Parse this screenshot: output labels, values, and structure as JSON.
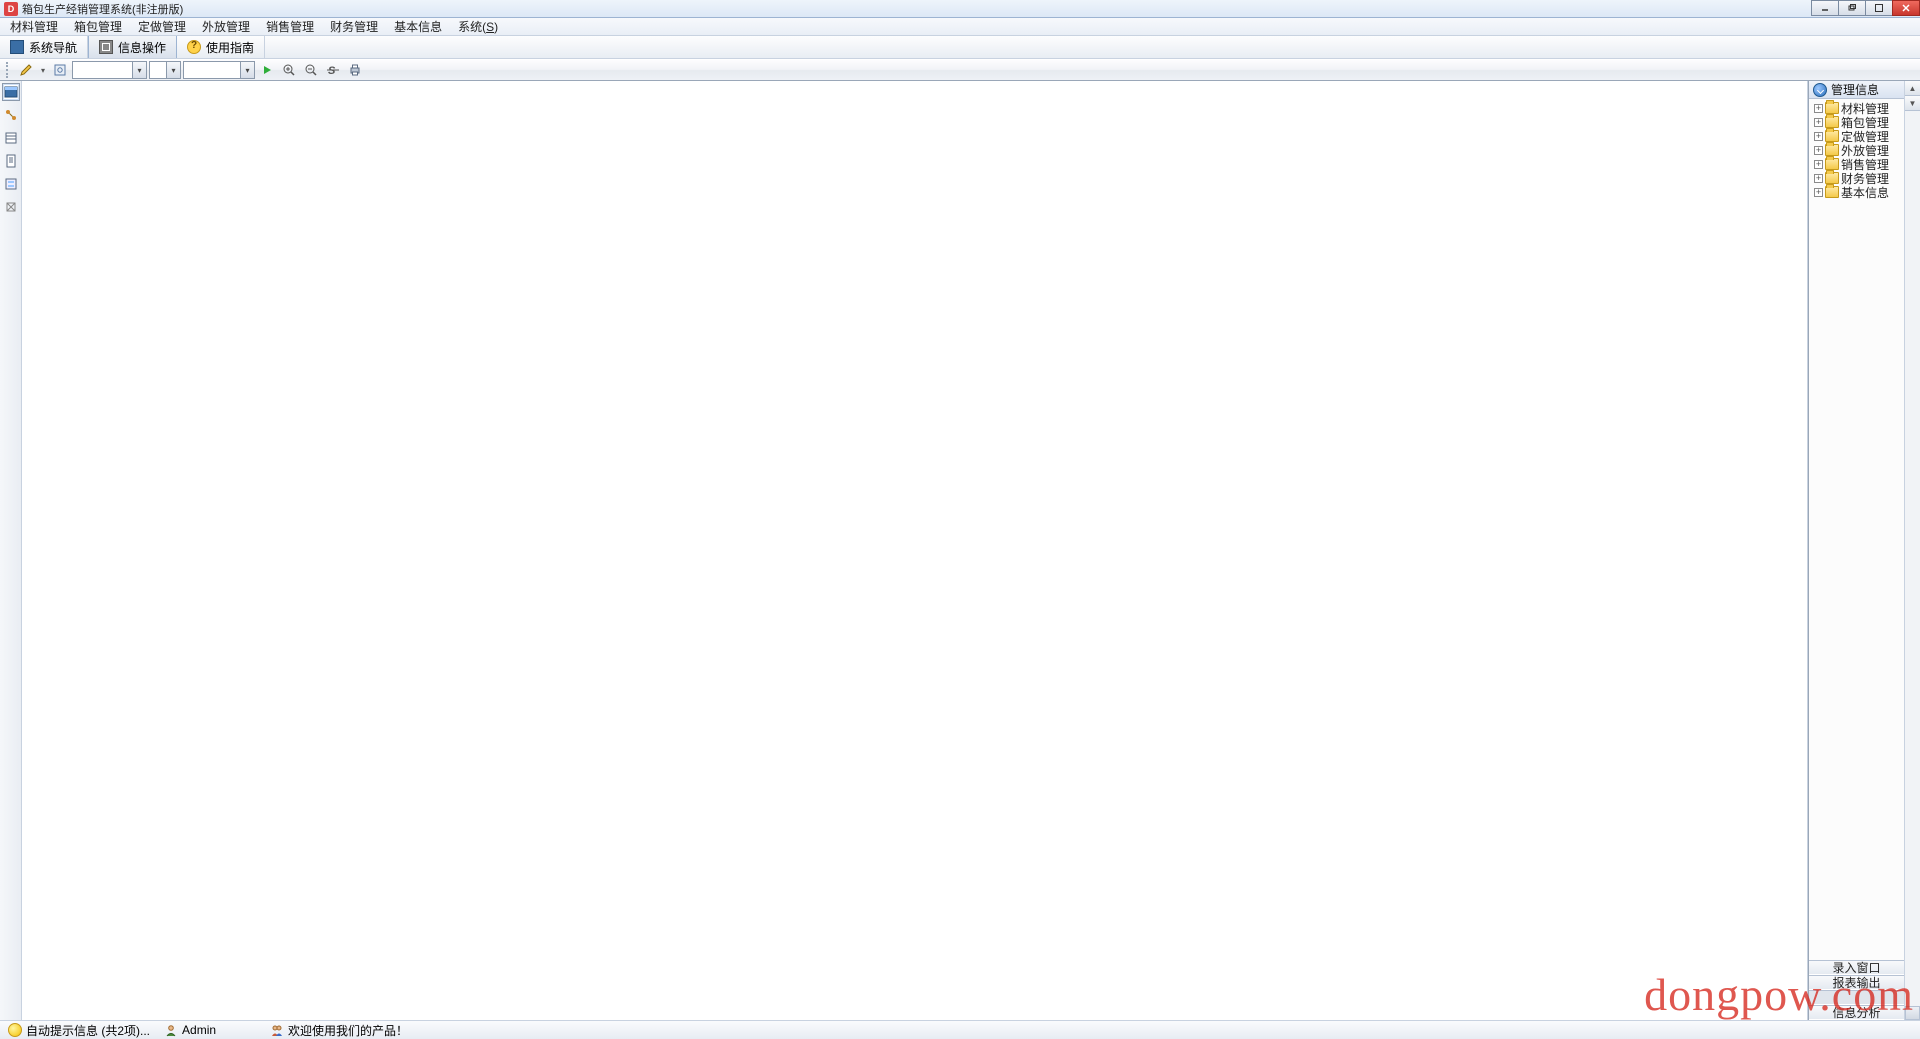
{
  "window": {
    "title": "箱包生产经销管理系统(非注册版)"
  },
  "menu": {
    "items": [
      "材料管理",
      "箱包管理",
      "定做管理",
      "外放管理",
      "销售管理",
      "财务管理",
      "基本信息"
    ],
    "system_label": "系统(",
    "system_key": "S",
    "system_close": ")"
  },
  "toolbar1": {
    "nav": "系统导航",
    "info": "信息操作",
    "help": "使用指南"
  },
  "toolbar2": {
    "combo_a": "",
    "combo_b": "",
    "combo_c": ""
  },
  "right": {
    "header": "管理信息",
    "tree": [
      "材料管理",
      "箱包管理",
      "定做管理",
      "外放管理",
      "销售管理",
      "财务管理",
      "基本信息"
    ],
    "stack": [
      "录入窗口",
      "报表输出",
      "信息分析"
    ]
  },
  "status": {
    "auto": "自动提示信息 (共2项)...",
    "user": "Admin",
    "welcome": "欢迎使用我们的产品！"
  },
  "watermark": "dongpow.com"
}
